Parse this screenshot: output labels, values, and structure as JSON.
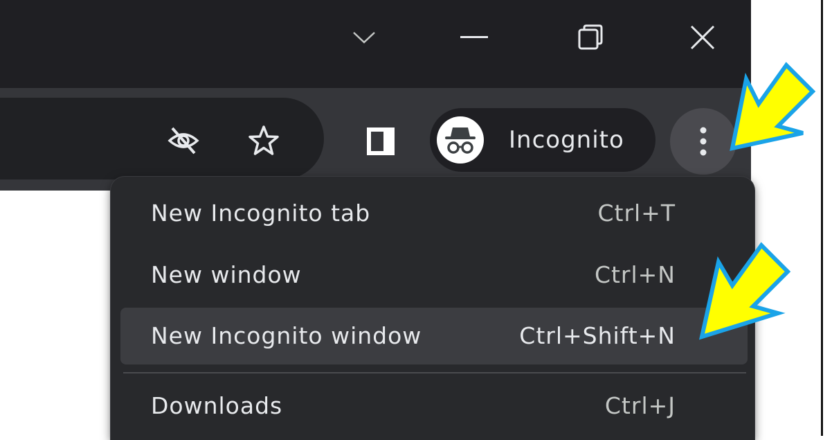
{
  "profile": {
    "label": "Incognito"
  },
  "menu": {
    "items": [
      {
        "label": "New Incognito tab",
        "shortcut": "Ctrl+T"
      },
      {
        "label": "New window",
        "shortcut": "Ctrl+N"
      },
      {
        "label": "New Incognito window",
        "shortcut": "Ctrl+Shift+N"
      },
      {
        "label": "Downloads",
        "shortcut": "Ctrl+J"
      }
    ]
  },
  "colors": {
    "titlebar": "#1f1f23",
    "toolbar": "#35363a",
    "menu_bg": "#28292c",
    "menu_hover": "#3c3d41",
    "annotation_arrow_fill": "#ffff00",
    "annotation_arrow_stroke": "#1aa3e8"
  },
  "icons": {
    "window_controls": [
      "chevron-down-icon",
      "minimize-icon",
      "restore-icon",
      "close-icon"
    ],
    "omnibox": [
      "eye-slash-icon",
      "star-icon"
    ],
    "toolbar": [
      "side-panel-icon",
      "incognito-icon",
      "kebab-menu-icon"
    ]
  }
}
